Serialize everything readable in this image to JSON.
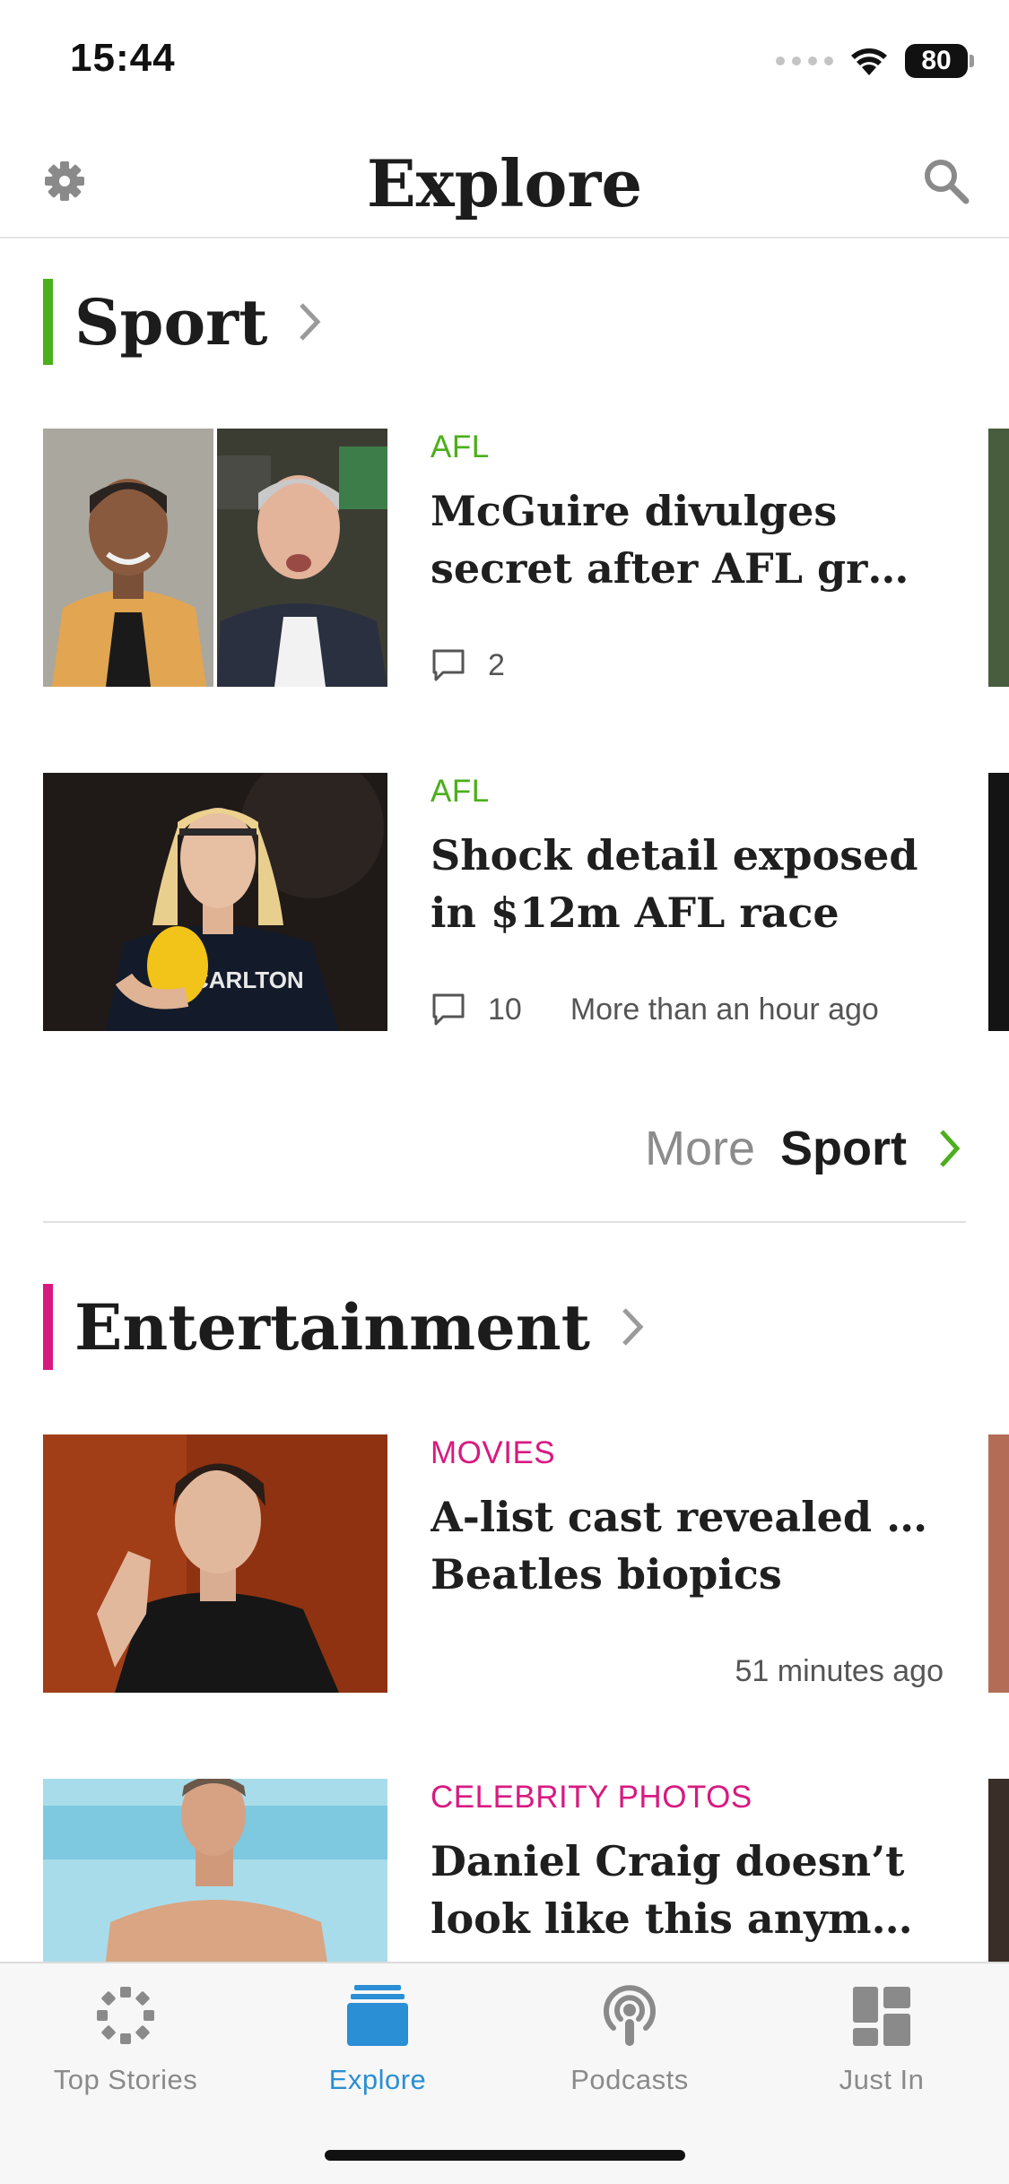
{
  "status_bar": {
    "time": "15:44",
    "battery": "80"
  },
  "header": {
    "title": "Explore"
  },
  "colors": {
    "sport": "#4caf1c",
    "entertainment": "#d81a80",
    "accent_blue": "#2a8fd4"
  },
  "sections": [
    {
      "title": "Sport",
      "articles": [
        {
          "category": "AFL",
          "headline_lines": [
            "McGuire divulges",
            "secret after AFL grea…"
          ],
          "comments": "2",
          "time": ""
        },
        {
          "category": "AFL",
          "headline_lines": [
            "Shock detail exposed",
            "in $12m AFL race"
          ],
          "comments": "10",
          "time": "More than an hour ago"
        }
      ],
      "more_label": "More",
      "more_section": "Sport"
    },
    {
      "title": "Entertainment",
      "articles": [
        {
          "category": "MOVIES",
          "headline_lines": [
            "A-list cast revealed for",
            "Beatles biopics"
          ],
          "comments": "",
          "time": "51 minutes ago"
        },
        {
          "category": "CELEBRITY PHOTOS",
          "headline_lines": [
            "Daniel Craig doesn’t",
            "look like this anymore"
          ],
          "comments": "",
          "time": ""
        }
      ]
    }
  ],
  "tabs": [
    {
      "label": "Top Stories",
      "icon": "top-stories-icon",
      "active": false
    },
    {
      "label": "Explore",
      "icon": "explore-icon",
      "active": true
    },
    {
      "label": "Podcasts",
      "icon": "podcasts-icon",
      "active": false
    },
    {
      "label": "Just In",
      "icon": "just-in-icon",
      "active": false
    }
  ]
}
